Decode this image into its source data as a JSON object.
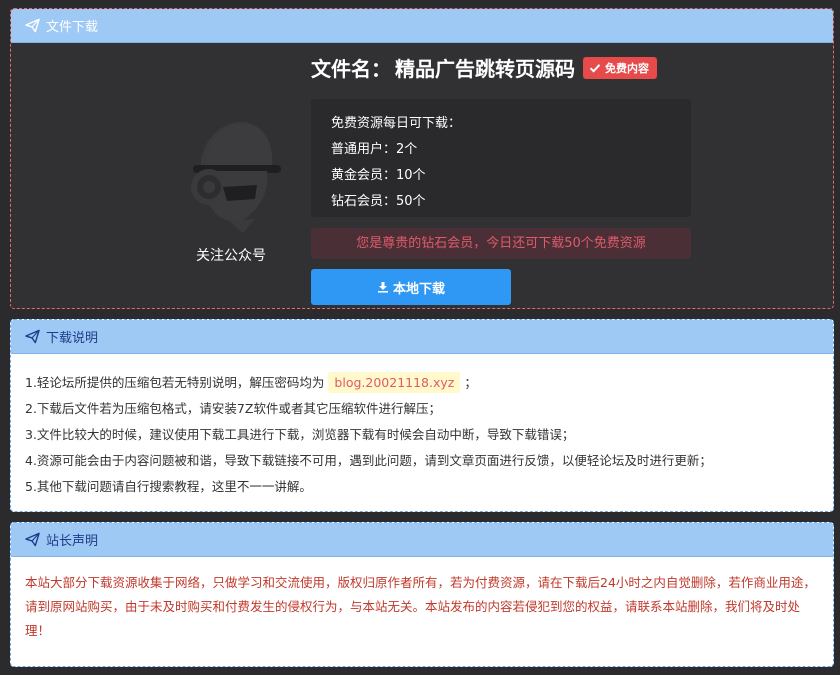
{
  "download_panel": {
    "header": "文件下载",
    "file_label": "文件名：",
    "file_name": "精品广告跳转页源码",
    "badge": "免费内容",
    "qr_label": "关注公众号",
    "quota": [
      "免费资源每日可下载：",
      "普通用户：2个",
      "黄金会员：10个",
      "钻石会员：50个"
    ],
    "status": "您是尊贵的钻石会员，今日还可下载50个免费资源",
    "download_button": "本地下载"
  },
  "instructions": {
    "header": "下载说明",
    "line1_prefix": "1.轻论坛所提供的压缩包若无特别说明，解压密码均为",
    "password": "blog.20021118.xyz",
    "line1_suffix": "；",
    "lines": [
      "2.下载后文件若为压缩包格式，请安装7Z软件或者其它压缩软件进行解压；",
      "3.文件比较大的时候，建议使用下载工具进行下载，浏览器下载有时候会自动中断，导致下载错误；",
      "4.资源可能会由于内容问题被和谐，导致下载链接不可用，遇到此问题，请到文章页面进行反馈，以便轻论坛及时进行更新；",
      "5.其他下载问题请自行搜索教程，这里不一一讲解。"
    ]
  },
  "statement": {
    "header": "站长声明",
    "text": "本站大部分下载资源收集于网络，只做学习和交流使用，版权归原作者所有，若为付费资源，请在下载后24小时之内自觉删除，若作商业用途，请到原网站购买，由于未及时购买和付费发生的侵权行为，与本站无关。本站发布的内容若侵犯到您的权益，请联系本站删除，我们将及时处理！"
  },
  "icons": {
    "header": "paper-plane-icon",
    "badge": "check-icon",
    "button": "download-icon",
    "avatar": "user-cap-avatar"
  },
  "colors": {
    "header_bg": "#9ec9f5",
    "button": "#2f97f4",
    "badge": "#e64a4a",
    "status_text": "#e05a6a",
    "statement_text": "#c0392b"
  }
}
